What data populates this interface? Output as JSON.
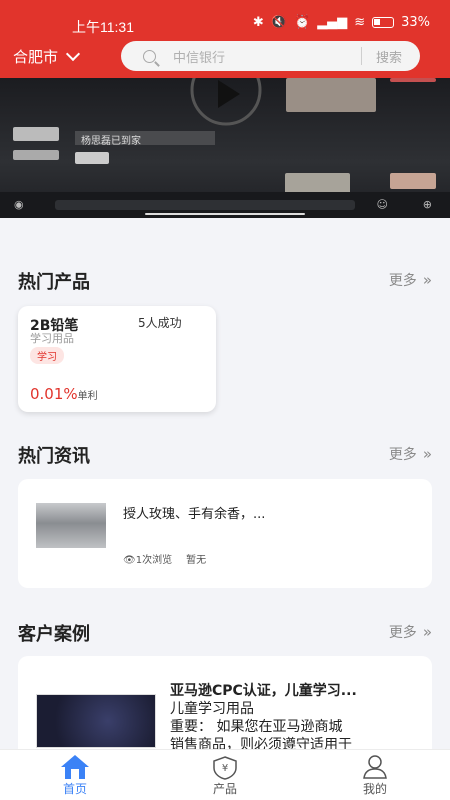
{
  "status": {
    "time": "上午11:31",
    "battery": "33%"
  },
  "header": {
    "city": "合肥市",
    "search_placeholder": "中信银行",
    "search_button": "搜索"
  },
  "banner": {
    "caption": "杨思磊已到家"
  },
  "sections": {
    "hot_products": {
      "title": "热门产品",
      "more": "更多"
    },
    "hot_news": {
      "title": "热门资讯",
      "more": "更多"
    },
    "cases": {
      "title": "客户案例",
      "more": "更多"
    }
  },
  "product": {
    "name": "2B铅笔",
    "success": "5人成功",
    "category": "学习用品",
    "tag": "学习",
    "rate": "0.01%",
    "rate_unit": "单利"
  },
  "news": {
    "title": "授人玫瑰、手有余香，...",
    "views": "1次浏览",
    "status": "暂无"
  },
  "case": {
    "title": "亚马逊CPC认证，儿童学习...",
    "line1": "儿童学习用品",
    "line2": "重要：  如果您在亚马逊商城",
    "line3": "销售商品，则必须遵守适用于"
  },
  "nav": {
    "items": [
      {
        "label": "首页",
        "active": true,
        "icon": "home-icon"
      },
      {
        "label": "产品",
        "active": false,
        "icon": "shield-yen-icon"
      },
      {
        "label": "我的",
        "active": false,
        "icon": "user-icon"
      }
    ]
  },
  "colors": {
    "brand": "#e1342c",
    "active_nav": "#3b82f6",
    "background": "#f3f4f8"
  }
}
